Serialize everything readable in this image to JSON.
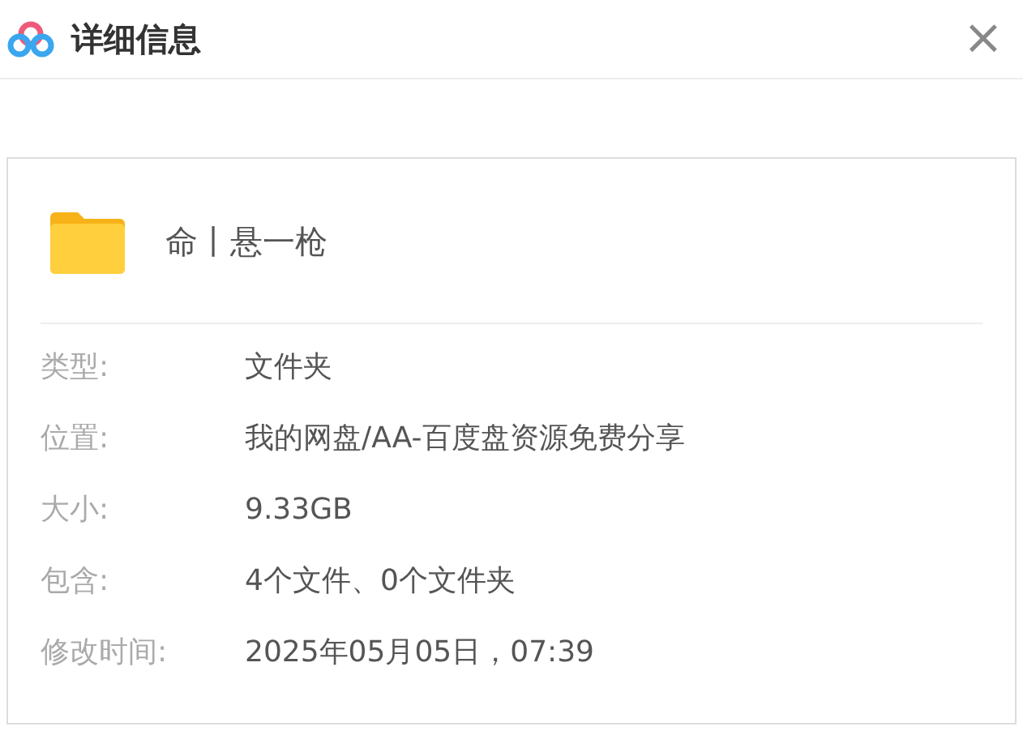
{
  "window": {
    "title": "详细信息",
    "close": "×"
  },
  "item": {
    "name": "命丨悬一枪"
  },
  "properties": [
    {
      "label": "类型:",
      "value": "文件夹"
    },
    {
      "label": "位置:",
      "value": "我的网盘/AA-百度盘资源免费分享"
    },
    {
      "label": "大小:",
      "value": "9.33GB"
    },
    {
      "label": "包含:",
      "value": "4个文件、0个文件夹"
    },
    {
      "label": "修改时间:",
      "value": "2025年05月05日，07:39"
    }
  ]
}
